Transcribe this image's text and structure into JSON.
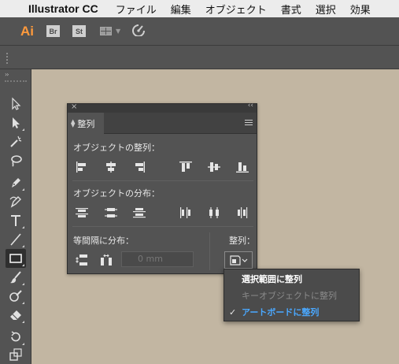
{
  "menubar": {
    "app_name": "Illustrator CC",
    "items": [
      "ファイル",
      "編集",
      "オブジェクト",
      "書式",
      "選択",
      "効果"
    ]
  },
  "appbar": {
    "logo": "Ai",
    "bridge": "Br",
    "stock": "St",
    "workspace_icon": "grid-icon",
    "gpu_icon": "gpu-performance-icon"
  },
  "tools": [
    "selection-tool-icon",
    "direct-selection-tool-icon",
    "magic-wand-tool-icon",
    "lasso-tool-icon",
    "pen-tool-icon",
    "curvature-tool-icon",
    "type-tool-icon",
    "line-tool-icon",
    "rectangle-tool-icon",
    "paintbrush-tool-icon",
    "shaper-tool-icon",
    "eraser-tool-icon",
    "rotate-tool-icon",
    "scale-tool-icon"
  ],
  "panel": {
    "tab_label": "整列",
    "align_objects_label": "オブジェクトの整列：",
    "distribute_objects_label": "オブジェクトの分布：",
    "distribute_spacing_label": "等間隔に分布：",
    "align_to_label": "整列：",
    "spacing_value": "0 mm"
  },
  "dropdown": {
    "items": [
      {
        "label": "選択範囲に整列",
        "state": "active"
      },
      {
        "label": "キーオブジェクトに整列",
        "state": "disabled"
      },
      {
        "label": "アートボードに整列",
        "state": "checked"
      }
    ]
  },
  "colors": {
    "canvas": "#c2b6a2",
    "panel": "#535353",
    "ai_orange": "#ff9a3c",
    "selected_blue": "#4aa8ff"
  }
}
